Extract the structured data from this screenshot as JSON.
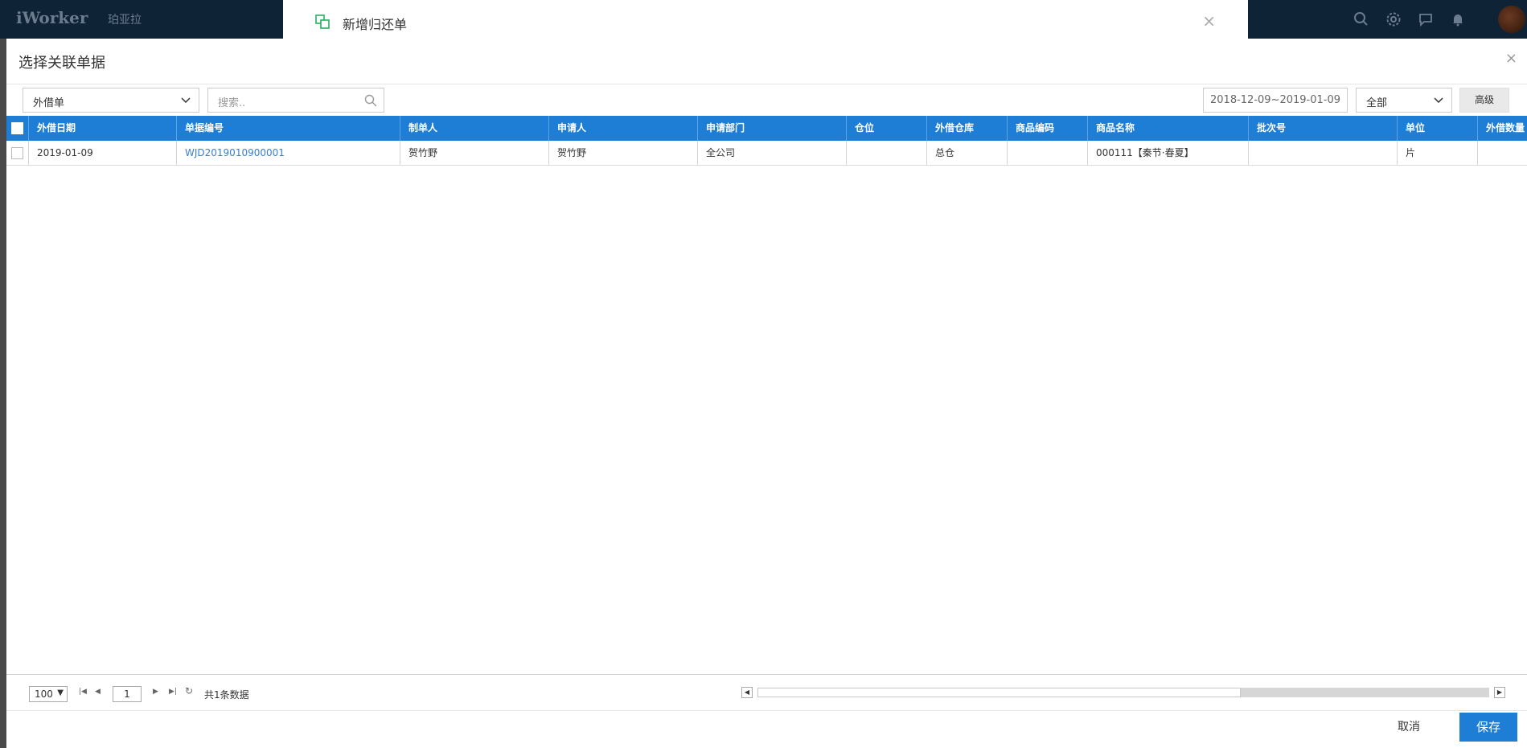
{
  "app": {
    "logo": "iWorker",
    "brand": "珀亚拉"
  },
  "drawer": {
    "title": "新增归还单"
  },
  "dialog": {
    "title": "选择关联单据",
    "type_select": "外借单",
    "search_placeholder": "搜索..",
    "date_range": "2018-12-09~2019-01-09",
    "status_select": "全部",
    "advanced_label": "高级"
  },
  "table": {
    "columns": [
      "外借日期",
      "单据编号",
      "制单人",
      "申请人",
      "申请部门",
      "仓位",
      "外借仓库",
      "商品编码",
      "商品名称",
      "批次号",
      "单位",
      "外借数量"
    ],
    "rows": [
      [
        "2019-01-09",
        "WJD2019010900001",
        "贺竹野",
        "贺竹野",
        "全公司",
        "",
        "总仓",
        "",
        "000111【秦节·春夏】",
        "",
        "片",
        ""
      ]
    ]
  },
  "pager": {
    "page_size": "100",
    "page": "1",
    "total": "共1条数据",
    "scroll_thumb_fraction": 0.66
  },
  "footer": {
    "cancel_label": "取消",
    "save_label": "保存"
  },
  "colors": {
    "header_blue": "#1e7dd4",
    "topbar": "#0f2336",
    "link": "#3a7fd0",
    "drawer_icon": "#27ae60"
  }
}
